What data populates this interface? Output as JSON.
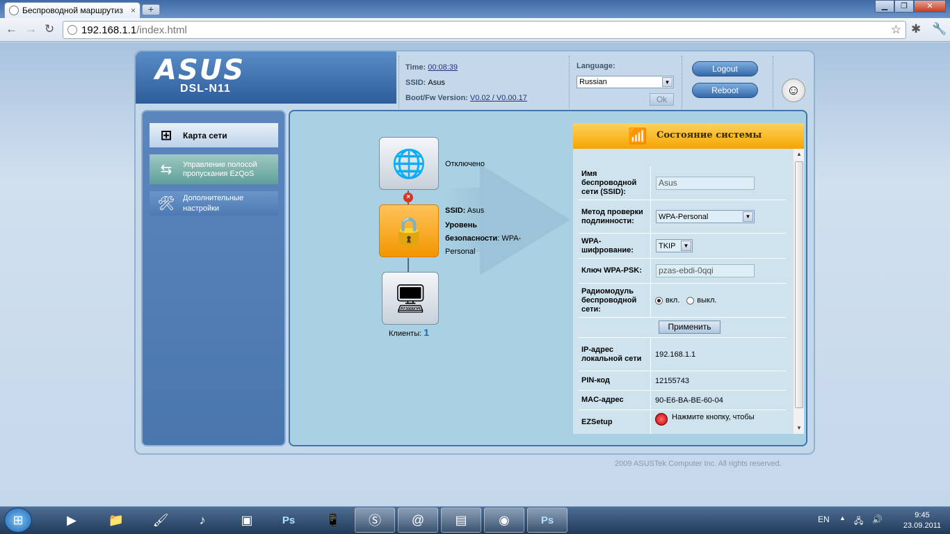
{
  "browser": {
    "tab_title": "Беспроводной маршрутиз",
    "tab_close": "×",
    "new_tab": "+",
    "url_host": "192.168.1.1",
    "url_path": "/index.html"
  },
  "header": {
    "logo_text": "ASUS",
    "model": "DSL-N11",
    "time_label": "Time:",
    "time_value": "00:08:39",
    "ssid_label": "SSID:",
    "ssid_value": "Asus",
    "fw_label": "Boot/Fw Version:",
    "fw_value": "V0.02 / V0.00.17",
    "language_label": "Language:",
    "language_value": "Russian",
    "ok_label": "Ok",
    "logout_label": "Logout",
    "reboot_label": "Reboot"
  },
  "sidebar": {
    "items": [
      {
        "label": "Карта сети"
      },
      {
        "label": "Управление полосой пропускания EzQoS"
      },
      {
        "label": "Дополнительные настройки"
      }
    ]
  },
  "map": {
    "internet_status": "Отключено",
    "ssid_label": "SSID:",
    "ssid_value": "Asus",
    "security_label_1": "Уровень",
    "security_label_2": "безопасности",
    "security_value_1": ": WPA-",
    "security_value_2": "Personal",
    "clients_label": "Клиенты:",
    "clients_count": "1"
  },
  "status": {
    "title": "Состояние системы",
    "ssid_label": "Имя беспроводной сети (SSID):",
    "ssid_value": "Asus",
    "auth_label": "Метод проверки подлинности:",
    "auth_value": "WPA-Personal",
    "enc_label": "WPA-шифрование:",
    "enc_value": "TKIP",
    "psk_label": "Ключ WPA-PSK:",
    "psk_value": "pzas-ebdi-0qqi",
    "radio_label": "Радиомодуль беспроводной сети:",
    "radio_on": "вкл.",
    "radio_off": "выкл.",
    "apply_label": "Применить",
    "ip_label": "IP-адрес локальной сети",
    "ip_value": "192.168.1.1",
    "pin_label": "PIN-код",
    "pin_value": "12155743",
    "mac_label": "MAC-адрес",
    "mac_value": "90-E6-BA-BE-60-04",
    "ezsetup_label": "EZSetup",
    "ezsetup_text": "Нажмите кнопку, чтобы"
  },
  "footer": "2009 ASUSTek Computer Inc. All rights reserved.",
  "taskbar": {
    "lang": "EN",
    "time": "9:45",
    "date": "23.09.2011",
    "ps_label": "Ps"
  }
}
